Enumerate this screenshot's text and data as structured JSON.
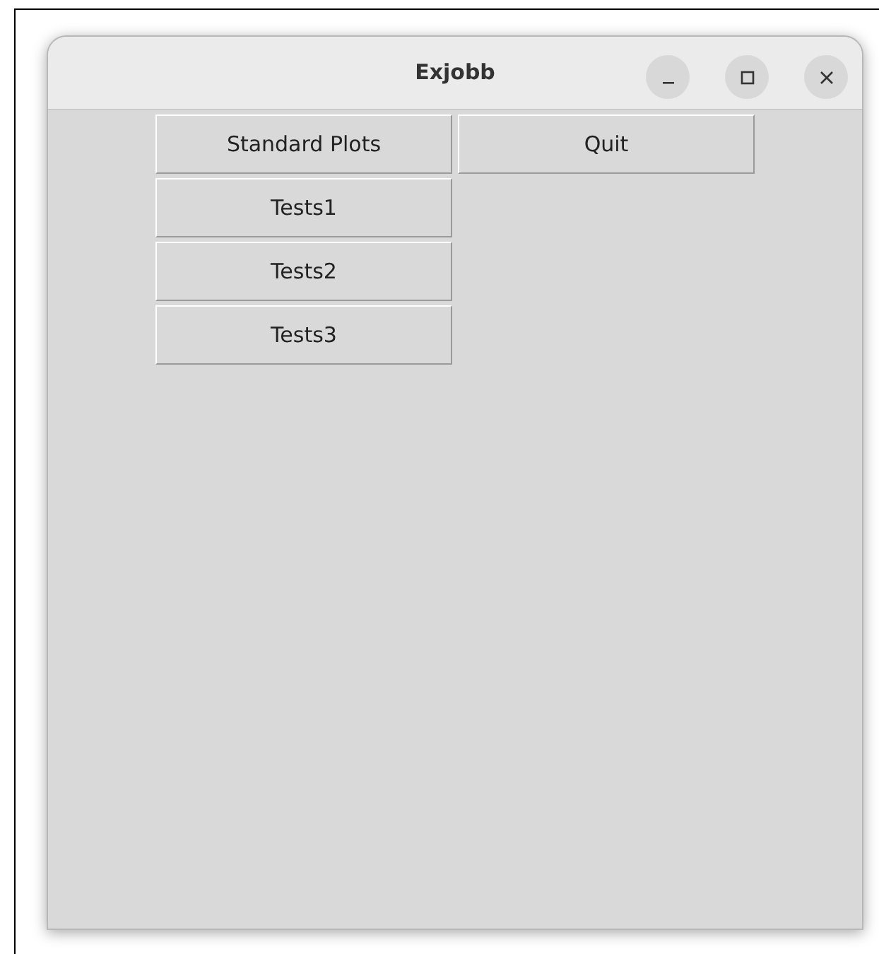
{
  "window": {
    "title": "Exjobb"
  },
  "rows": [
    {
      "buttons": [
        "Standard Plots",
        "Quit"
      ]
    },
    {
      "buttons": [
        "Tests1"
      ]
    },
    {
      "buttons": [
        "Tests2"
      ]
    },
    {
      "buttons": [
        "Tests3"
      ]
    }
  ]
}
